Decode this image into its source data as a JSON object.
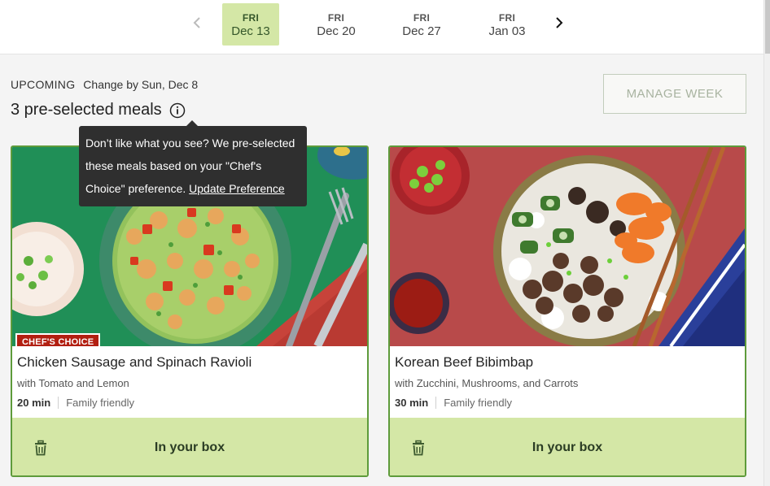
{
  "week_nav": {
    "prev_icon": "chevron-left-icon",
    "next_icon": "chevron-right-icon",
    "dates": [
      {
        "dow": "FRI",
        "date": "Dec 13",
        "active": true
      },
      {
        "dow": "FRI",
        "date": "Dec 20",
        "active": false
      },
      {
        "dow": "FRI",
        "date": "Dec 27",
        "active": false
      },
      {
        "dow": "FRI",
        "date": "Jan 03",
        "active": false
      }
    ]
  },
  "header": {
    "status": "UPCOMING",
    "change_by": "Change by Sun, Dec 8",
    "title": "3 pre-selected meals",
    "info_icon": "info-icon",
    "manage_week_label": "MANAGE WEEK"
  },
  "tooltip": {
    "text": "Don’t like what you see? We pre-selected these meals based on your \"Chef's Choice\" preference.",
    "link": "Update Preference"
  },
  "meals": [
    {
      "badge": "CHEF'S CHOICE",
      "title": "Chicken Sausage and Spinach Ravioli",
      "subtitle": "with Tomato and Lemon",
      "time": "20 min",
      "tag": "Family friendly",
      "action": "In your box",
      "action_icon": "trash-icon"
    },
    {
      "badge": "",
      "title": "Korean Beef Bibimbap",
      "subtitle": "with Zucchini, Mushrooms, and Carrots",
      "time": "30 min",
      "tag": "Family friendly",
      "action": "In your box",
      "action_icon": "trash-icon"
    }
  ],
  "colors": {
    "accent_green": "#5e9b3b",
    "selected_bg": "#d4e7a6",
    "badge_red": "#b21f11",
    "tooltip_bg": "#2f2f2f"
  }
}
